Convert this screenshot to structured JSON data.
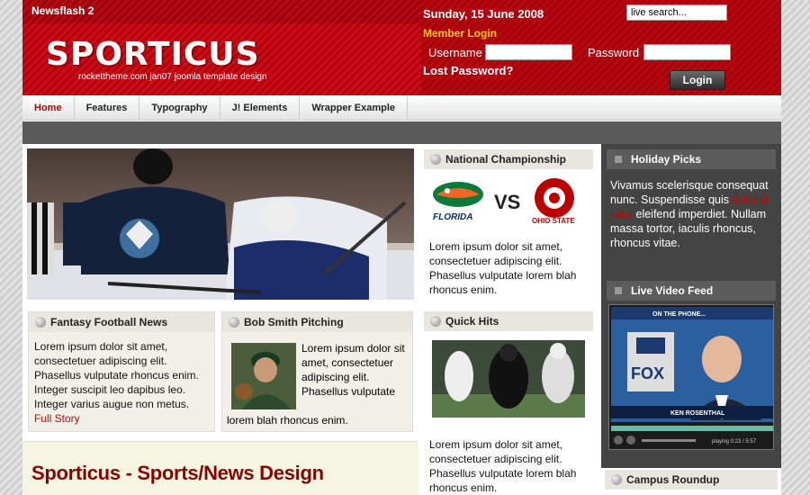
{
  "header": {
    "newsflash": "Newsflash 2",
    "logo": "SPORTICUS",
    "tagline": "rockettheme.com jan07 joomla template design",
    "date": "Sunday, 15 June 2008",
    "search_value": "live search...",
    "member_login": "Member Login",
    "username_label": "Username",
    "password_label": "Password",
    "lost_password": "Lost Password?",
    "login_button": "Login"
  },
  "nav": {
    "items": [
      "Home",
      "Features",
      "Typography",
      "J! Elements",
      "Wrapper Example"
    ]
  },
  "modules": {
    "fantasy": {
      "title": "Fantasy Football News",
      "body": "Lorem ipsum dolor sit amet, consectetuer adipiscing elit. Phasellus vulputate rhoncus enim. Integer suscipit leo dapibus leo. Integer varius augue non metus.",
      "link": "Full Story"
    },
    "bob": {
      "title": "Bob Smith Pitching",
      "body1": "Lorem ipsum dolor sit amet, consectetuer adipiscing elit. Phasellus vulputate",
      "body2": "lorem blah rhoncus enim."
    },
    "national": {
      "title": "National Championship",
      "team1": "FLORIDA",
      "vs": "VS",
      "team2": "OHIO STATE",
      "body": "Lorem ipsum dolor sit amet, consectetuer adipiscing elit. Phasellus vulputate lorem blah rhoncus enim."
    },
    "quick": {
      "title": "Quick Hits",
      "body": "Lorem ipsum dolor sit amet, consectetuer adipiscing elit. Phasellus vulputate lorem blah rhoncus enim."
    },
    "holiday": {
      "title": "Holiday Picks",
      "body_a": "Vivamus scelerisque consequat nunc. Suspendisse quis ",
      "body_red": "dolor id urna",
      "body_b": " eleifend imperdiet. Nullam massa tortor, iaculis rhoncus, rhoncus vitae."
    },
    "video": {
      "title": "Live Video Feed",
      "caption_top": "ON THE PHONE...",
      "network": "FOX",
      "caption_bottom": "KEN ROSENTHAL",
      "time": "playing 0:23 / 5:57"
    },
    "campus": {
      "title": "Campus Roundup"
    }
  },
  "main_title": "Sporticus - Sports/News Design",
  "colors": {
    "brand_red": "#c8101a",
    "accent_yellow": "#ffcc00",
    "title_red": "#8b0000",
    "link_red": "#cc0000"
  }
}
